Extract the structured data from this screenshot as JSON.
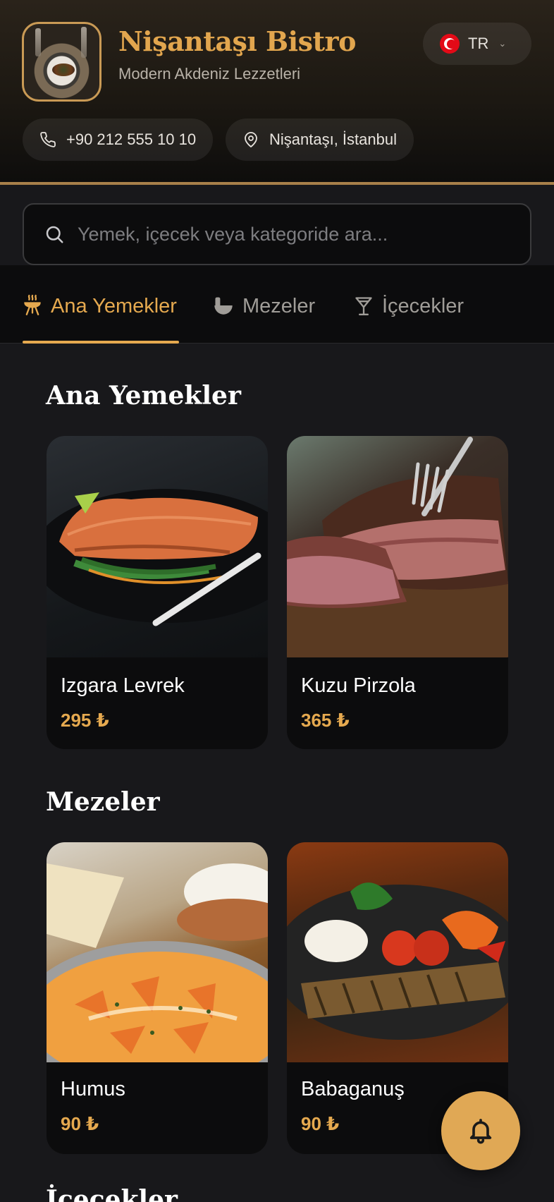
{
  "restaurant": {
    "name": "Nişantaşı Bistro",
    "tagline": "Modern Akdeniz Lezzetleri",
    "phone": "+90 212 555 10 10",
    "location": "Nişantaşı, İstanbul"
  },
  "language": {
    "code": "TR",
    "flag": "turkey-flag"
  },
  "search": {
    "placeholder": "Yemek, içecek veya kategoride ara..."
  },
  "tabs": [
    {
      "label": "Ana Yemekler",
      "icon": "grill-icon",
      "active": true
    },
    {
      "label": "Mezeler",
      "icon": "mortar-icon",
      "active": false
    },
    {
      "label": "İçecekler",
      "icon": "cocktail-icon",
      "active": false
    }
  ],
  "sections": [
    {
      "title": "Ana Yemekler",
      "items": [
        {
          "name": "Izgara Levrek",
          "price": "295 ₺"
        },
        {
          "name": "Kuzu Pirzola",
          "price": "365 ₺"
        }
      ]
    },
    {
      "title": "Mezeler",
      "items": [
        {
          "name": "Humus",
          "price": "90 ₺"
        },
        {
          "name": "Babaganuş",
          "price": "90 ₺"
        }
      ]
    }
  ],
  "next_section_peek": "İçecekler",
  "colors": {
    "accent": "#e5a94f",
    "background": "#18181b",
    "card": "#0c0c0d"
  },
  "fab": {
    "icon": "bell-icon"
  }
}
